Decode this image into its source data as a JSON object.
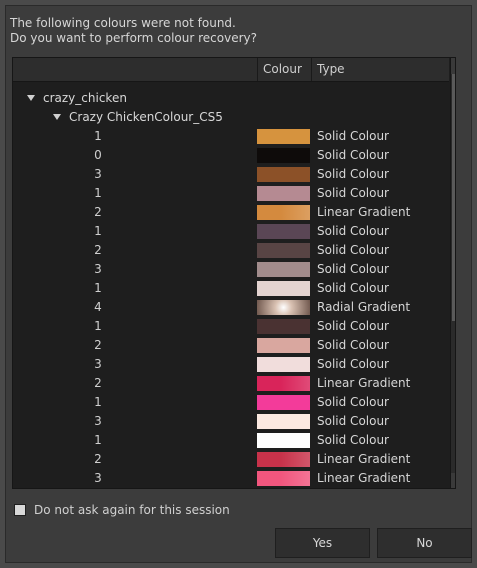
{
  "message": {
    "line1": "The following colours were not found.",
    "line2": "Do you want to perform colour recovery?"
  },
  "table": {
    "headers": {
      "colour": "Colour",
      "type": "Type"
    },
    "root": "crazy_chicken",
    "palette": "Crazy ChickenColour_CS5",
    "rows": [
      {
        "count": "1",
        "color": "#d6933e",
        "type": "Solid Colour"
      },
      {
        "count": "0",
        "color": "#0e0b0a",
        "type": "Solid Colour"
      },
      {
        "count": "3",
        "color": "#8c5128",
        "type": "Solid Colour"
      },
      {
        "count": "1",
        "color": "#b58a92",
        "type": "Solid Colour"
      },
      {
        "count": "2",
        "color": "#d48a3e",
        "type": "Linear Gradient"
      },
      {
        "count": "1",
        "color": "#5a4655",
        "type": "Solid Colour"
      },
      {
        "count": "2",
        "color": "#584444",
        "type": "Solid Colour"
      },
      {
        "count": "3",
        "color": "#a28c8c",
        "type": "Solid Colour"
      },
      {
        "count": "1",
        "color": "#e3d3d0",
        "type": "Solid Colour"
      },
      {
        "count": "4",
        "color": "#d9c1b2",
        "type": "Radial Gradient"
      },
      {
        "count": "1",
        "color": "#4a3232",
        "type": "Solid Colour"
      },
      {
        "count": "2",
        "color": "#d9a79f",
        "type": "Solid Colour"
      },
      {
        "count": "3",
        "color": "#f1dddc",
        "type": "Solid Colour"
      },
      {
        "count": "2",
        "color": "#d9245a",
        "type": "Linear Gradient"
      },
      {
        "count": "1",
        "color": "#f33b9a",
        "type": "Solid Colour"
      },
      {
        "count": "3",
        "color": "#fbe8e0",
        "type": "Solid Colour"
      },
      {
        "count": "1",
        "color": "#ffffff",
        "type": "Solid Colour"
      },
      {
        "count": "2",
        "color": "#c8324a",
        "type": "Linear Gradient"
      },
      {
        "count": "3",
        "color": "#f2567e",
        "type": "Linear Gradient"
      }
    ]
  },
  "checkbox": {
    "label": "Do not ask again for this session",
    "checked": false
  },
  "buttons": {
    "yes": "Yes",
    "no": "No"
  }
}
